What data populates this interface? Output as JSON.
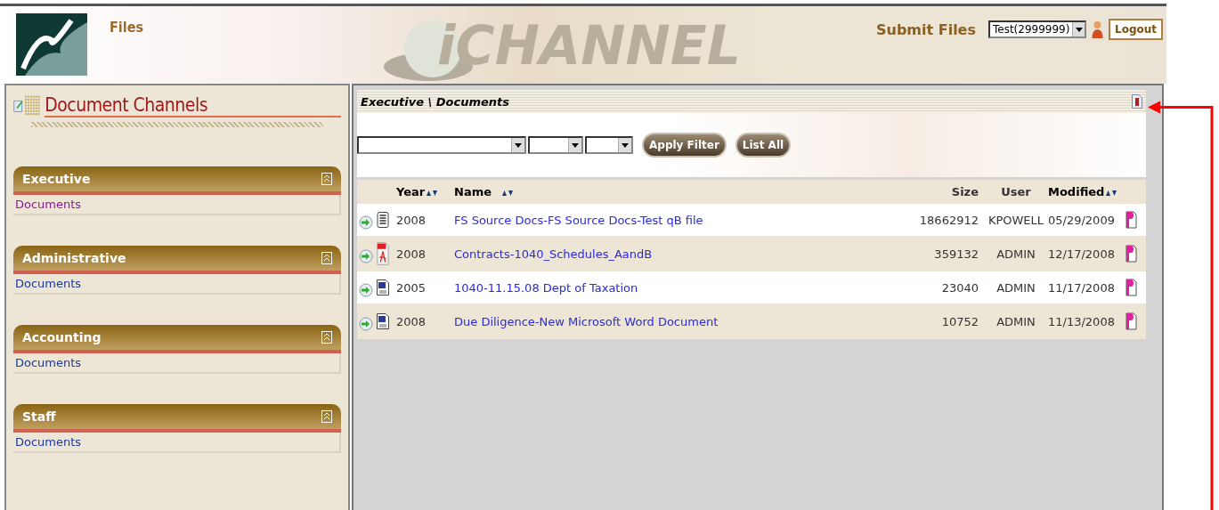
{
  "header": {
    "nav_link": "Files",
    "banner_text": "iCHANNEL",
    "submit_link": "Submit Files",
    "account_select": {
      "value": "Test(2999999)"
    },
    "logout_button": "Logout"
  },
  "sidebar": {
    "title": "Document Channels",
    "channels": [
      {
        "name": "Executive",
        "expanded": true,
        "items": [
          {
            "label": "Documents",
            "selected": true
          }
        ]
      },
      {
        "name": "Administrative",
        "expanded": true,
        "items": [
          {
            "label": "Documents",
            "selected": false
          }
        ]
      },
      {
        "name": "Accounting",
        "expanded": true,
        "items": [
          {
            "label": "Documents",
            "selected": false
          }
        ]
      },
      {
        "name": "Staff",
        "expanded": true,
        "items": [
          {
            "label": "Documents",
            "selected": false
          }
        ]
      }
    ]
  },
  "breadcrumb": {
    "channel": "Executive",
    "separator": "\\",
    "folder": "Documents"
  },
  "filter": {
    "apply_button": "Apply Filter",
    "list_all_button": "List All"
  },
  "table": {
    "columns": [
      {
        "label": "Year",
        "sortable": true
      },
      {
        "label": "Name",
        "sortable": true
      },
      {
        "label": "Size",
        "sortable": false
      },
      {
        "label": "User",
        "sortable": false
      },
      {
        "label": "Modified",
        "sortable": true
      }
    ],
    "rows": [
      {
        "kind": "text",
        "year": "2008",
        "name": "FS Source Docs-FS Source Docs-Test qB file",
        "size": "18662912",
        "user": "KPOWELL",
        "modified": "05/29/2009"
      },
      {
        "kind": "pdf",
        "year": "2008",
        "name": "Contracts-1040_Schedules_AandB",
        "size": "359132",
        "user": "ADMIN",
        "modified": "12/17/2008"
      },
      {
        "kind": "word",
        "year": "2005",
        "name": "1040-11.15.08 Dept of Taxation",
        "size": "23040",
        "user": "ADMIN",
        "modified": "11/17/2008"
      },
      {
        "kind": "word",
        "year": "2008",
        "name": "Due Diligence-New Microsoft Word Document",
        "size": "10752",
        "user": "ADMIN",
        "modified": "11/13/2008"
      }
    ]
  }
}
